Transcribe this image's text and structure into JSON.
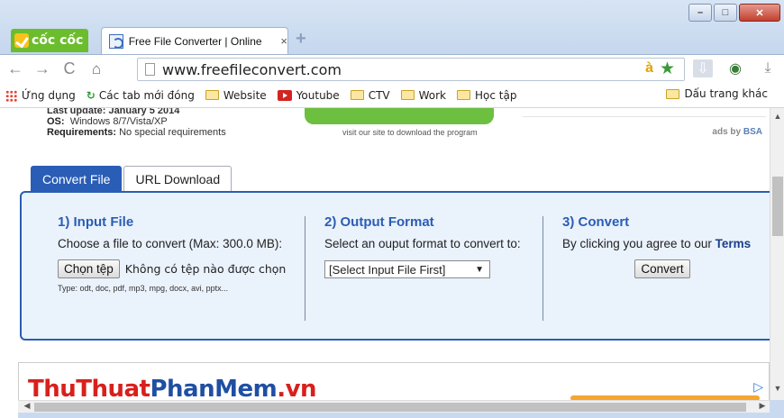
{
  "browser": {
    "logo_text": "cốc cốc",
    "tab_title": "Free File Converter | Online",
    "tab_close": "×",
    "new_tab": "+",
    "win_min": "–",
    "win_max": "□",
    "win_close": "✕",
    "url": "www.freefileconvert.com",
    "addr_a": "à",
    "back": "←",
    "forward": "→",
    "reload": "C",
    "home": "⌂"
  },
  "bookmarks": {
    "apps": "Ứng dụng",
    "recent_tabs": "Các tab mới đóng",
    "items": [
      "Website",
      "Youtube",
      "CTV",
      "Work",
      "Học tập"
    ],
    "more": "»",
    "other": "Dấu trang khác"
  },
  "page": {
    "last_update": "Last update: January 5 2014",
    "os_label": "OS:",
    "os_value": "Windows 8/7/Vista/XP",
    "req_label": "Requirements:",
    "req_value": "No special requirements",
    "visit_text": "visit our site to download the program",
    "ads_prefix": "ads by ",
    "ads_brand": "BSA",
    "tabs": [
      "Convert File",
      "URL Download"
    ],
    "input": {
      "title": "1) Input File",
      "desc": "Choose a file to convert (Max: 300.0 MB):",
      "choose_btn": "Chọn tệp",
      "no_file": "Không có tệp nào được chọn",
      "types": "Type: odt, doc, pdf, mp3, mpg, docx, avi, pptx..."
    },
    "output": {
      "title": "2) Output Format",
      "desc": "Select an ouput format to convert to:",
      "select_value": "[Select Input File First]"
    },
    "convert": {
      "title": "3) Convert",
      "desc_prefix": "By clicking you agree to our ",
      "terms": "Terms",
      "button": "Convert"
    },
    "ad_logo_red": "ThuThuat",
    "ad_logo_blue": "PhanMem",
    "ad_logo_red2": ".vn"
  },
  "colors": {
    "accent": "#2a5db5",
    "panel_bg": "#eaf2fc",
    "brand_green": "#6bbd2d"
  }
}
